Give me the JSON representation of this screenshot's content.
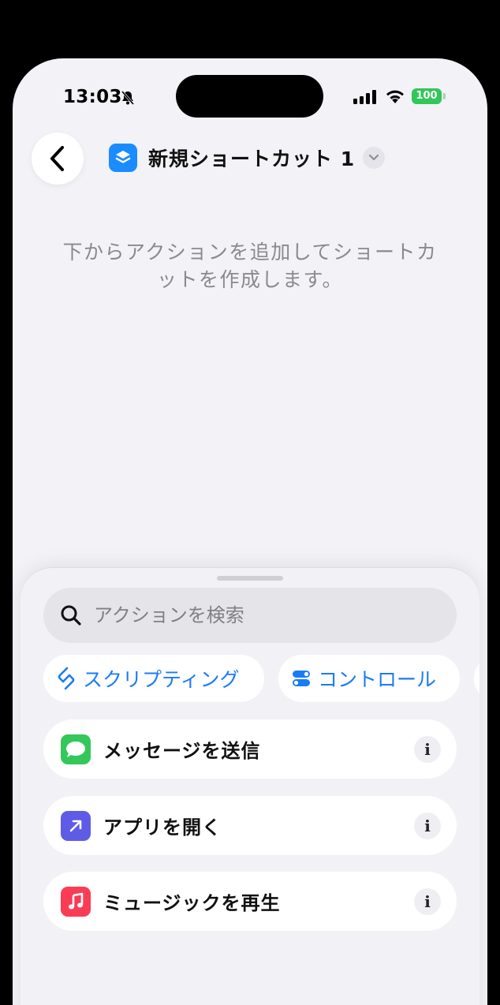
{
  "status_bar": {
    "time": "13:03",
    "battery": "100",
    "silent_mode": true
  },
  "header": {
    "title": "新規ショートカット 1",
    "shortcut_icon": "layers-icon",
    "accent_color": "#1a8cff"
  },
  "empty_hint": "下からアクションを追加してショートカットを作成します。",
  "action_sheet": {
    "search_placeholder": "アクションを検索",
    "categories": [
      {
        "label": "スクリプティング",
        "icon": "scripting-icon"
      },
      {
        "label": "コントロール",
        "icon": "toggle-icon"
      }
    ],
    "actions": [
      {
        "label": "メッセージを送信",
        "icon": "messages-icon",
        "color": "#34c759"
      },
      {
        "label": "アプリを開く",
        "icon": "open-app-icon",
        "color": "#5e5ce6"
      },
      {
        "label": "ミュージックを再生",
        "icon": "music-icon",
        "color": "#fa3c55"
      }
    ],
    "info_glyph": "i"
  }
}
